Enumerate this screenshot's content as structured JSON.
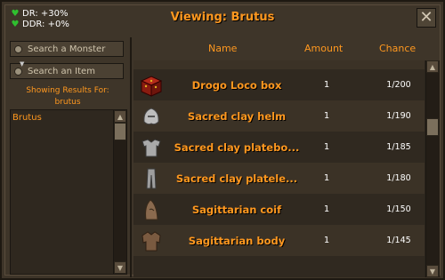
{
  "window": {
    "title": "Viewing: Brutus",
    "close_icon": "close-icon"
  },
  "stats": [
    {
      "icon": "heart-icon",
      "label": "DR: +30%"
    },
    {
      "icon": "heart-icon",
      "label": "DDR: +0%"
    }
  ],
  "left": {
    "search_monster_label": "Search a Monster",
    "search_item_label": "Search an Item",
    "showing_label": "Showing Results For:",
    "query": "brutus",
    "results": [
      "Brutus"
    ]
  },
  "table": {
    "headers": {
      "name": "Name",
      "amount": "Amount",
      "chance": "Chance"
    },
    "rows": [
      {
        "icon": "drogo-loco-box-icon",
        "name": "Drogo Loco box",
        "amount": "1",
        "chance": "1/200"
      },
      {
        "icon": "sacred-clay-helm-icon",
        "name": "Sacred clay helm",
        "amount": "1",
        "chance": "1/190"
      },
      {
        "icon": "sacred-clay-platebody-icon",
        "name": "Sacred clay platebo...",
        "amount": "1",
        "chance": "1/185"
      },
      {
        "icon": "sacred-clay-platelegs-icon",
        "name": "Sacred clay platele...",
        "amount": "1",
        "chance": "1/180"
      },
      {
        "icon": "sagittarian-coif-icon",
        "name": "Sagittarian coif",
        "amount": "1",
        "chance": "1/150"
      },
      {
        "icon": "sagittarian-body-icon",
        "name": "Sagittarian body",
        "amount": "1",
        "chance": "1/145"
      }
    ]
  },
  "colors": {
    "accent": "#ff981f",
    "panel": "#3e3529",
    "text": "#ffffff"
  }
}
